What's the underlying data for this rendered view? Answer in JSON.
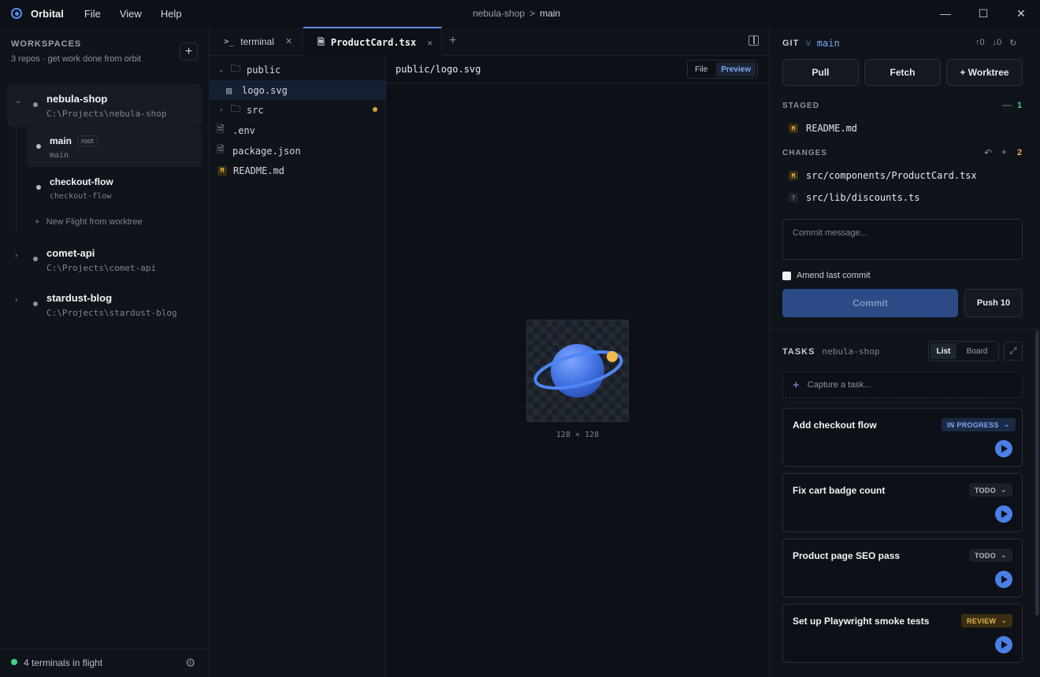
{
  "app": {
    "name": "Orbital",
    "menu": [
      "File",
      "View",
      "Help"
    ]
  },
  "titlebar": {
    "repo": "nebula-shop",
    "separator": ">",
    "branch": "main"
  },
  "sidebar": {
    "title": "WORKSPACES",
    "subtitle": "3 repos · get work done from orbit",
    "repos": [
      {
        "name": "nebula-shop",
        "path": "C:\\Projects\\nebula-shop"
      },
      {
        "name": "comet-api",
        "path": "C:\\Projects\\comet-api"
      },
      {
        "name": "stardust-blog",
        "path": "C:\\Projects\\stardust-blog"
      }
    ],
    "worktrees": [
      {
        "name": "main",
        "badge": "root",
        "branch": "main"
      },
      {
        "name": "checkout-flow",
        "branch": "checkout-flow"
      }
    ],
    "new_flight": "New Flight from worktree",
    "footer": "4 terminals in flight"
  },
  "tabs": [
    {
      "label": "terminal",
      "icon": ">_"
    },
    {
      "label": "ProductCard.tsx"
    }
  ],
  "filetree": {
    "items": [
      {
        "name": "public"
      },
      {
        "name": "logo.svg"
      },
      {
        "name": "src"
      },
      {
        "name": ".env"
      },
      {
        "name": "package.json"
      },
      {
        "name": "README.md",
        "badge": "M"
      }
    ]
  },
  "preview": {
    "path": "public/logo.svg",
    "toggle": {
      "file": "File",
      "preview": "Preview"
    },
    "dims": "128 × 128"
  },
  "git": {
    "title": "GIT",
    "branch": "main",
    "buttons": {
      "pull": "Pull",
      "fetch": "Fetch",
      "worktree": "Worktree"
    },
    "staged": {
      "label": "STAGED",
      "count": "1",
      "files": [
        {
          "badge": "M",
          "name": "README.md"
        }
      ]
    },
    "changes": {
      "label": "CHANGES",
      "count": "2",
      "files": [
        {
          "badge": "M",
          "name": "src/components/ProductCard.tsx"
        },
        {
          "badge": "?",
          "name": "src/lib/discounts.ts"
        }
      ]
    },
    "commit_placeholder": "Commit message...",
    "amend_label": "Amend last commit",
    "commit_label": "Commit",
    "push_label": "Push 10"
  },
  "tasks": {
    "title": "TASKS",
    "repo": "nebula-shop",
    "toggle": {
      "list": "List",
      "board": "Board"
    },
    "capture_placeholder": "Capture a task...",
    "items": [
      {
        "title": "Add checkout flow",
        "status": "IN PROGRESS"
      },
      {
        "title": "Fix cart badge count",
        "status": "TODO"
      },
      {
        "title": "Product page SEO pass",
        "status": "TODO"
      },
      {
        "title": "Set up Playwright smoke tests",
        "status": "REVIEW"
      }
    ]
  }
}
